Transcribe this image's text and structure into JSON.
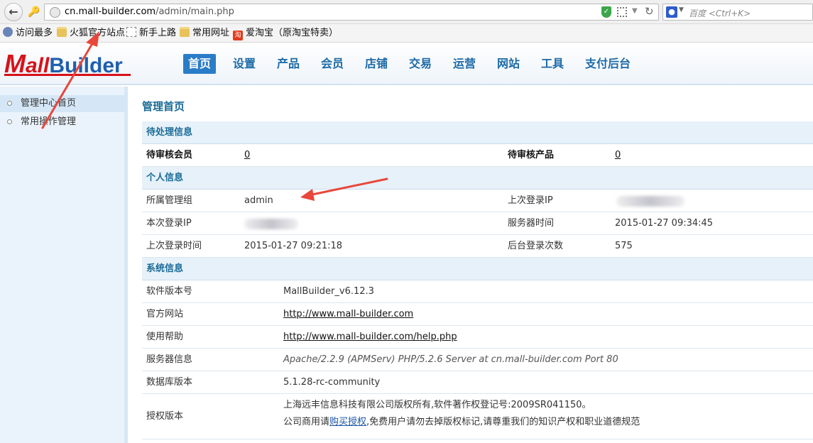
{
  "browser": {
    "url_host": "cn.mall-builder.com",
    "url_path": "/admin/main.php",
    "search_placeholder": "百度 <Ctrl+K>",
    "bookmarks": [
      {
        "label": "访问最多",
        "icon": "gear"
      },
      {
        "label": "火狐官方站点",
        "icon": "folder"
      },
      {
        "label": "新手上路",
        "icon": "dashed"
      },
      {
        "label": "常用网址",
        "icon": "folder"
      },
      {
        "label": "爱淘宝（原淘宝特卖）",
        "icon": "tao"
      }
    ],
    "tao_glyph": "淘"
  },
  "app": {
    "logo": {
      "m": "M",
      "rest1": "all",
      "rest2": "Builder"
    },
    "nav": [
      "首页",
      "设置",
      "产品",
      "会员",
      "店铺",
      "交易",
      "运营",
      "网站",
      "工具",
      "支付后台"
    ],
    "active_nav_index": 0
  },
  "sidebar": {
    "items": [
      "管理中心首页",
      "常用操作管理"
    ],
    "active_index": 0
  },
  "main": {
    "title": "管理首页",
    "pending": {
      "header": "待处理信息",
      "members_label": "待审核会员",
      "members_value": "0",
      "products_label": "待审核产品",
      "products_value": "0"
    },
    "personal": {
      "header": "个人信息",
      "group_label": "所属管理组",
      "group_value": "admin",
      "last_ip_label": "上次登录IP",
      "current_ip_label": "本次登录IP",
      "server_time_label": "服务器时间",
      "server_time_value": "2015-01-27 09:34:45",
      "last_login_label": "上次登录时间",
      "last_login_value": "2015-01-27 09:21:18",
      "login_count_label": "后台登录次数",
      "login_count_value": "575"
    },
    "system": {
      "header": "系统信息",
      "version_label": "软件版本号",
      "version_value": "MallBuilder_v6.12.3",
      "site_label": "官方网站",
      "site_value": "http://www.mall-builder.com",
      "help_label": "使用帮助",
      "help_value": "http://www.mall-builder.com/help.php",
      "server_label": "服务器信息",
      "server_value": "Apache/2.2.9 (APMServ) PHP/5.2.6 Server at cn.mall-builder.com Port 80",
      "db_label": "数据库版本",
      "db_value": "5.1.28-rc-community",
      "license_label": "授权版本",
      "license_line1": "上海远丰信息科技有限公司版权所有,软件著作权登记号:2009SR041150。",
      "license_line2_pre": "公司商用请",
      "license_line2_link": "购买授权",
      "license_line2_post": ",免费用户请勿去掉版权标记,请尊重我们的知识产权和职业道德规范"
    }
  },
  "colors": {
    "accent": "#2a7cc7",
    "brand_red": "#d7121a",
    "section_bg": "#e6f1fa",
    "annotation": "#e8473a"
  }
}
